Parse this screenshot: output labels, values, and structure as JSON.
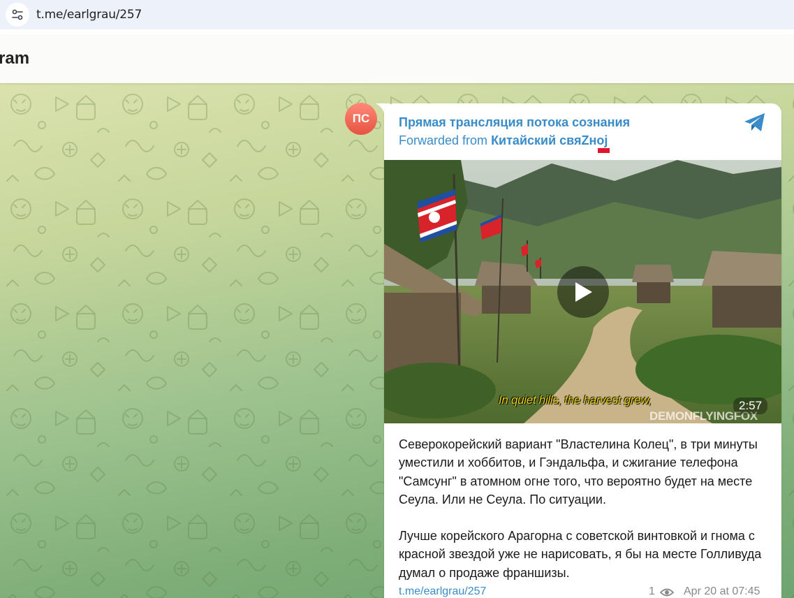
{
  "browser": {
    "url": "t.me/earlgrau/257",
    "site_info_icon": "tune-icon"
  },
  "header": {
    "title": "ram"
  },
  "avatar": {
    "initials": "ПС",
    "color": "#ea5c49"
  },
  "message": {
    "channel_name": "Прямая трансляция потока сознания",
    "forwarded_prefix": "Forwarded from",
    "forwarded_source": "Китайский свяZноj",
    "accent_color": "#3a8cc8",
    "video": {
      "duration": "2:57",
      "subtitle": "In quiet hills, the harvest grew,",
      "watermark": "DEMONFLYINGFOX"
    },
    "paragraphs": [
      "Северокорейский вариант \"Властелина Колец\", в три минуты уместили и хоббитов, и Гэндальфа, и сжигание телефона \"Самсунг\" в атомном огне того, что вероятно будет на месте Сеула. Или не Сеула. По ситуации.",
      "Лучше корейского Арагорна с советской винтовкой и гнома с красной звездой уже не нарисовать, я бы на месте Голливуда думал о продаже франшизы."
    ],
    "link": "t.me/earlgrau/257",
    "views": "1",
    "date": "Apr 20 at 07:45"
  }
}
